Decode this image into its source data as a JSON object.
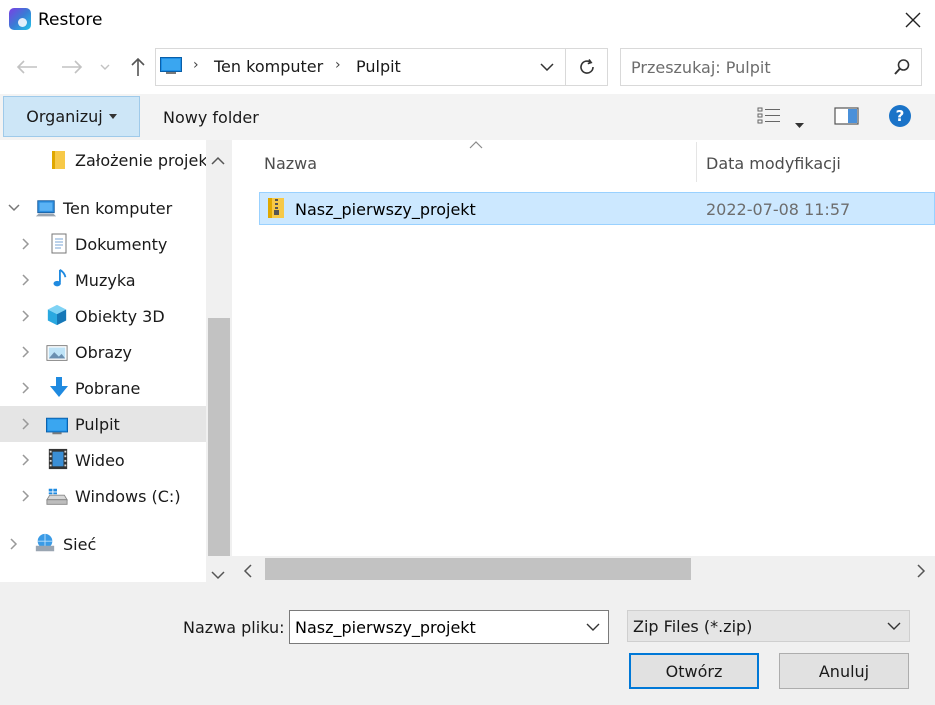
{
  "window": {
    "title": "Restore"
  },
  "address": {
    "crumbs": [
      "Ten komputer",
      "Pulpit"
    ]
  },
  "search": {
    "placeholder": "Przeszukaj: Pulpit"
  },
  "toolbar": {
    "organize_label": "Organizuj",
    "new_folder_label": "Nowy folder"
  },
  "tree": {
    "items": [
      {
        "label": "Założenie projek",
        "icon": "folder-icon"
      },
      {
        "label": "Ten komputer",
        "icon": "computer-icon"
      },
      {
        "label": "Dokumenty",
        "icon": "documents-icon"
      },
      {
        "label": "Muzyka",
        "icon": "music-icon"
      },
      {
        "label": "Obiekty 3D",
        "icon": "cube-icon"
      },
      {
        "label": "Obrazy",
        "icon": "pictures-icon"
      },
      {
        "label": "Pobrane",
        "icon": "download-icon"
      },
      {
        "label": "Pulpit",
        "icon": "desktop-icon"
      },
      {
        "label": "Wideo",
        "icon": "video-icon"
      },
      {
        "label": "Windows (C:)",
        "icon": "drive-icon"
      },
      {
        "label": "Sieć",
        "icon": "network-icon"
      }
    ]
  },
  "list": {
    "columns": {
      "name": "Nazwa",
      "date": "Data modyfikacji"
    },
    "rows": [
      {
        "name": "Nasz_pierwszy_projekt",
        "date": "2022-07-08 11:57",
        "icon": "zip-folder-icon"
      }
    ]
  },
  "footer": {
    "filename_label": "Nazwa pliku:",
    "filename_value": "Nasz_pierwszy_projekt",
    "filetype": "Zip Files (*.zip)",
    "open_label": "Otwórz",
    "cancel_label": "Anuluj"
  },
  "colors": {
    "selection": "#cce8ff",
    "accent": "#0078d7",
    "help": "#1a73c8"
  }
}
